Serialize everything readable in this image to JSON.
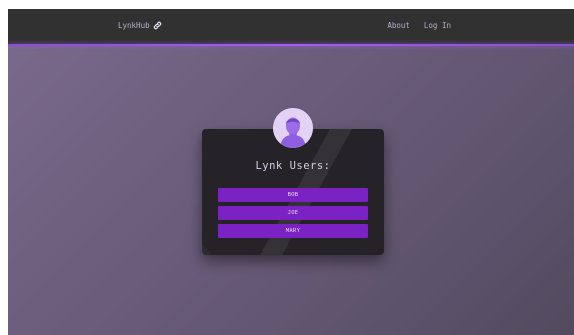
{
  "navbar": {
    "brand": "LynkHub",
    "brand_icon": "link-icon",
    "links": [
      "About",
      "Log In"
    ]
  },
  "card": {
    "title": "Lynk Users:",
    "avatar_icon": "user-avatar-icon",
    "users": [
      "BOB",
      "JOE",
      "MARY"
    ]
  },
  "colors": {
    "navbar_bg": "#313131",
    "accent": "#a45cf0",
    "button_bg": "#7a22c4",
    "card_bg": "#252328"
  }
}
